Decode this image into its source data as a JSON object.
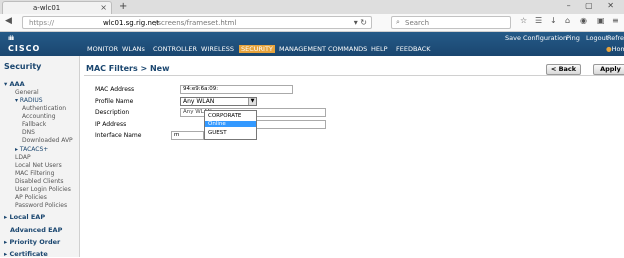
{
  "browser": {
    "tab_title": "a-wlc01",
    "close_glyph": "×",
    "new_tab_glyph": "+",
    "window_controls": "– ▢ ✕",
    "url": {
      "scheme": "https://",
      "host": "wlc01.sg.rig.net",
      "path": "/screens/frameset.html"
    },
    "search_placeholder": "Search"
  },
  "header": {
    "logo_text": "CISCO",
    "top_links": [
      "Save Configuration",
      "Ping",
      "Logout",
      "Refresh"
    ],
    "home_label": "Home",
    "menu": [
      "MONITOR",
      "WLANs",
      "CONTROLLER",
      "WIRELESS",
      "SECURITY",
      "MANAGEMENT",
      "COMMANDS",
      "HELP",
      "FEEDBACK"
    ],
    "active_menu": "SECURITY"
  },
  "sidebar": {
    "title": "Security",
    "aaa": "▾ AAA",
    "general": "General",
    "radius": "▾ RADIUS",
    "radius_items": [
      "Authentication",
      "Accounting",
      "Fallback",
      "DNS",
      "Downloaded AVP"
    ],
    "tacacs": "▸ TACACS+",
    "items": [
      "LDAP",
      "Local Net Users",
      "MAC Filtering",
      "Disabled Clients",
      "User Login Policies",
      "AP Policies",
      "Password Policies"
    ],
    "local_eap": "▸ Local EAP",
    "advanced_eap": "Advanced EAP",
    "priority_order": "▸ Priority Order",
    "certificate": "▸ Certificate"
  },
  "main": {
    "title": "MAC Filters > New",
    "back_label": "< Back",
    "apply_label": "Apply",
    "labels": [
      "MAC Address",
      "Profile Name",
      "Description",
      "IP Address",
      "Interface Name"
    ],
    "mac_value": "94:e9:6a:09:",
    "profile_selected": "Any WLAN",
    "description_value": "Any WLAN",
    "interface_value": "m",
    "dropdown_options": [
      "CORPORATE",
      "Online",
      "GUEST"
    ],
    "dropdown_highlight": "Online"
  },
  "colors": {
    "header_blue": "#1a466f",
    "active_tab": "#e6a33c",
    "highlight": "#3399ff"
  }
}
